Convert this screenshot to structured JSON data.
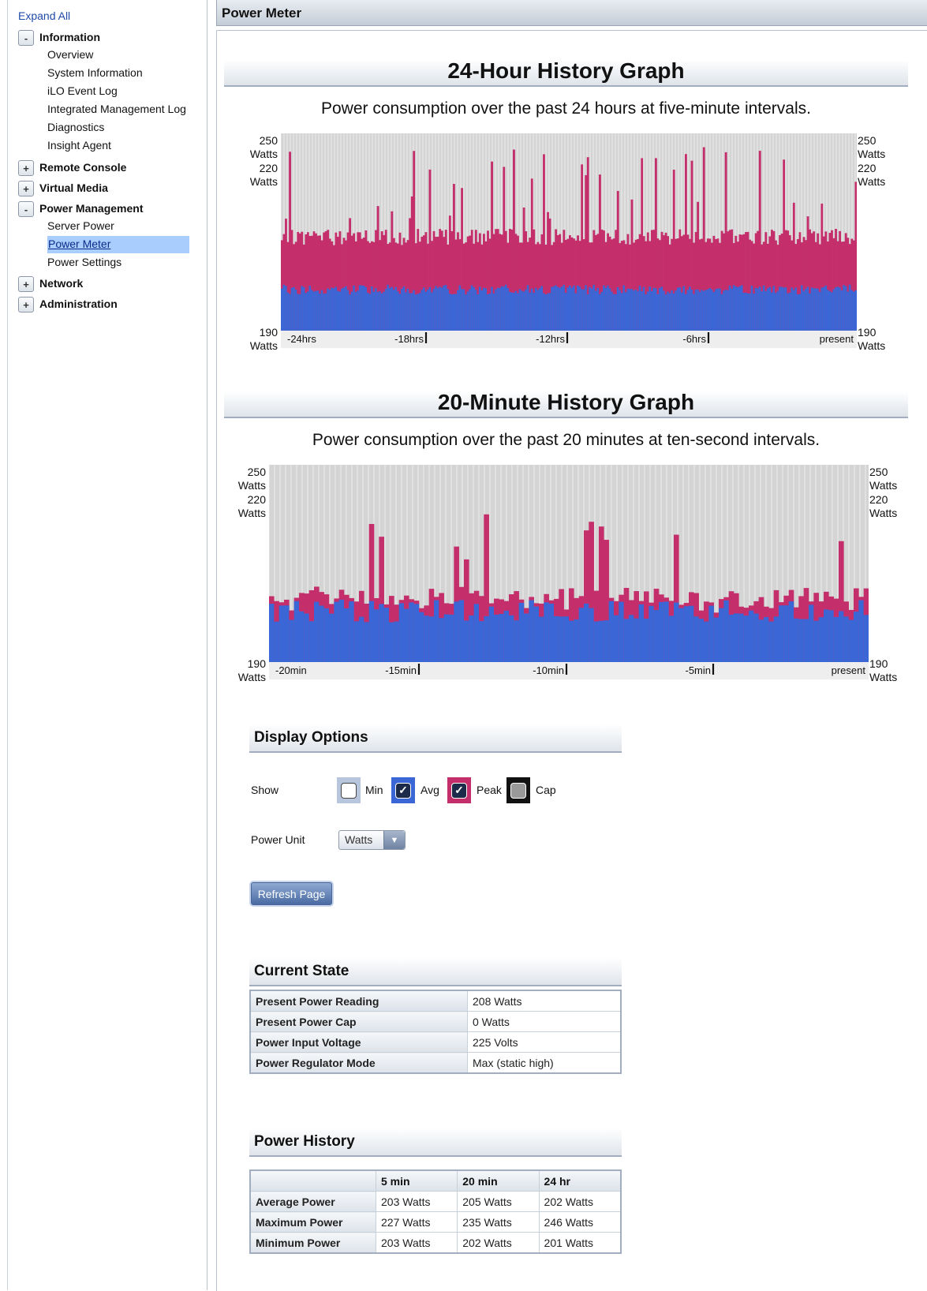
{
  "sidebar": {
    "expand_all": "Expand All",
    "categories": [
      {
        "label": "Information",
        "toggle": "-",
        "items": [
          "Overview",
          "System Information",
          "iLO Event Log",
          "Integrated Management Log",
          "Diagnostics",
          "Insight Agent"
        ]
      },
      {
        "label": "Remote Console",
        "toggle": "+",
        "items": []
      },
      {
        "label": "Virtual Media",
        "toggle": "+",
        "items": []
      },
      {
        "label": "Power Management",
        "toggle": "-",
        "items": [
          "Server Power",
          "Power Meter",
          "Power Settings"
        ]
      },
      {
        "label": "Network",
        "toggle": "+",
        "items": []
      },
      {
        "label": "Administration",
        "toggle": "+",
        "items": []
      }
    ],
    "active_item": "Power Meter"
  },
  "header": {
    "title": "Power Meter"
  },
  "graphs": [
    {
      "title": "24-Hour History Graph",
      "subtitle": "Power consumption over the past 24 hours at five-minute intervals.",
      "y_top": "250",
      "y_mid": "220",
      "y_bottom": "190",
      "unit": "Watts",
      "ticks": [
        "-24hrs",
        "-18hrs",
        "-12hrs",
        "-6hrs",
        "present"
      ]
    },
    {
      "title": "20-Minute History Graph",
      "subtitle": "Power consumption over the past 20 minutes at ten-second intervals.",
      "y_top": "250",
      "y_mid": "220",
      "y_bottom": "190",
      "unit": "Watts",
      "ticks": [
        "-20min",
        "-15min",
        "-10min",
        "-5min",
        "present"
      ]
    }
  ],
  "chart_data": [
    {
      "type": "bar",
      "title": "24-Hour History Graph",
      "x": [
        "-24hrs",
        "-18hrs",
        "-12hrs",
        "-6hrs",
        "present"
      ],
      "ylim": [
        190,
        250
      ],
      "series": [
        {
          "name": "Avg",
          "approx_range": [
            201,
            204
          ]
        },
        {
          "name": "Peak",
          "approx_range": [
            216,
            246
          ]
        }
      ]
    },
    {
      "type": "bar",
      "title": "20-Minute History Graph",
      "x": [
        "-20min",
        "-15min",
        "-10min",
        "-5min",
        "present"
      ],
      "ylim": [
        190,
        250
      ],
      "series": [
        {
          "name": "Avg",
          "approx_range": [
            202,
            209
          ]
        },
        {
          "name": "Peak",
          "approx_range": [
            205,
            235
          ]
        }
      ]
    }
  ],
  "display_options": {
    "title": "Display Options",
    "show_label": "Show",
    "checkboxes": [
      {
        "label": "Min",
        "checked": false,
        "color": "#b8c6dd"
      },
      {
        "label": "Avg",
        "checked": true,
        "color": "#3b67d6"
      },
      {
        "label": "Peak",
        "checked": true,
        "color": "#c42e6b"
      },
      {
        "label": "Cap",
        "checked": false,
        "color": "#111111"
      }
    ],
    "power_unit_label": "Power Unit",
    "power_unit_value": "Watts",
    "refresh_label": "Refresh Page"
  },
  "current_state": {
    "title": "Current State",
    "rows": [
      {
        "label": "Present Power Reading",
        "value": "208 Watts"
      },
      {
        "label": "Present Power Cap",
        "value": "0 Watts"
      },
      {
        "label": "Power Input Voltage",
        "value": "225 Volts"
      },
      {
        "label": "Power Regulator Mode",
        "value": "Max (static high)"
      }
    ]
  },
  "power_history": {
    "title": "Power History",
    "columns": [
      "5 min",
      "20 min",
      "24 hr"
    ],
    "rows": [
      {
        "label": "Average Power",
        "values": [
          "203 Watts",
          "205 Watts",
          "202 Watts"
        ]
      },
      {
        "label": "Maximum Power",
        "values": [
          "227 Watts",
          "235 Watts",
          "246 Watts"
        ]
      },
      {
        "label": "Minimum Power",
        "values": [
          "203 Watts",
          "202 Watts",
          "201 Watts"
        ]
      }
    ]
  },
  "colors": {
    "avg": "#3b67d6",
    "peak": "#c42e6b",
    "bg_bar": "#d4d4d4",
    "grid": "#f4f4f4"
  }
}
